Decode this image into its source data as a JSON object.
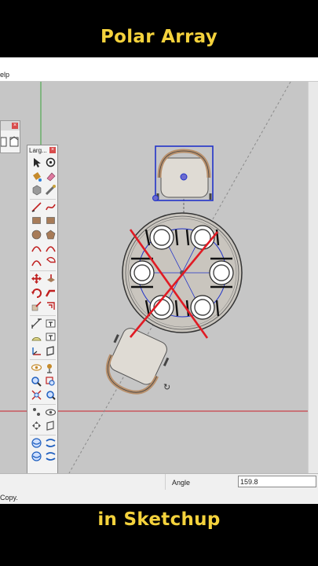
{
  "captions": {
    "top": "Polar Array",
    "bottom": "in Sketchup"
  },
  "menubar": {
    "visible_fragment": "elp"
  },
  "toolbars": {
    "large_tool_set": {
      "title": "Larg...",
      "tools": [
        {
          "name": "select-tool-icon",
          "color": "#2a2a2a",
          "shape": "arrow"
        },
        {
          "name": "orbit-tool-icon",
          "color": "#2a2a2a",
          "shape": "orbit"
        },
        {
          "name": "paint-bucket-icon",
          "color": "#c58a2b",
          "shape": "bucket"
        },
        {
          "name": "eraser-icon",
          "color": "#e07aa0",
          "shape": "eraser"
        },
        {
          "name": "make-component-icon",
          "color": "#9a9a9a",
          "shape": "cube"
        },
        {
          "name": "tape-measure-icon",
          "color": "#6b6b6b",
          "shape": "tape"
        },
        {
          "name": "line-tool-icon",
          "color": "#c02020",
          "shape": "line"
        },
        {
          "name": "freehand-tool-icon",
          "color": "#c02020",
          "shape": "freehand"
        },
        {
          "name": "rectangle-tool-icon",
          "color": "#a77b58",
          "shape": "rect"
        },
        {
          "name": "rotated-rectangle-icon",
          "color": "#a77b58",
          "shape": "rect"
        },
        {
          "name": "circle-tool-icon",
          "color": "#a77b58",
          "shape": "circle"
        },
        {
          "name": "polygon-tool-icon",
          "color": "#a77b58",
          "shape": "poly"
        },
        {
          "name": "arc-tool-icon",
          "color": "#c02020",
          "shape": "arc"
        },
        {
          "name": "two-point-arc-icon",
          "color": "#c02020",
          "shape": "arc"
        },
        {
          "name": "three-point-arc-icon",
          "color": "#c02020",
          "shape": "arc"
        },
        {
          "name": "pie-tool-icon",
          "color": "#c02020",
          "shape": "pie"
        },
        {
          "name": "move-tool-icon",
          "color": "#c02020",
          "shape": "move"
        },
        {
          "name": "push-pull-icon",
          "color": "#a77b58",
          "shape": "pushpull"
        },
        {
          "name": "rotate-tool-icon",
          "color": "#c02020",
          "shape": "rotate"
        },
        {
          "name": "follow-me-icon",
          "color": "#c02020",
          "shape": "followme"
        },
        {
          "name": "scale-tool-icon",
          "color": "#c02020",
          "shape": "scale"
        },
        {
          "name": "offset-tool-icon",
          "color": "#c02020",
          "shape": "offset"
        },
        {
          "name": "dimension-tool-icon",
          "color": "#333333",
          "shape": "dimension"
        },
        {
          "name": "text-tool-icon",
          "color": "#333333",
          "shape": "text"
        },
        {
          "name": "protractor-icon",
          "color": "#6a6a20",
          "shape": "protractor"
        },
        {
          "name": "3d-text-icon",
          "color": "#333333",
          "shape": "text"
        },
        {
          "name": "axes-tool-icon",
          "color": "#333333",
          "shape": "axes"
        },
        {
          "name": "section-plane-icon",
          "color": "#333333",
          "shape": "section"
        },
        {
          "name": "look-around-icon",
          "color": "#c58a2b",
          "shape": "eye"
        },
        {
          "name": "position-camera-icon",
          "color": "#c58a2b",
          "shape": "camera"
        },
        {
          "name": "zoom-tool-icon",
          "color": "#1f5fbf",
          "shape": "zoom"
        },
        {
          "name": "zoom-window-icon",
          "color": "#c02020",
          "shape": "zoomwin"
        },
        {
          "name": "zoom-extents-icon",
          "color": "#c02020",
          "shape": "extents"
        },
        {
          "name": "previous-view-icon",
          "color": "#1f5fbf",
          "shape": "prev"
        },
        {
          "name": "walk-tool-icon",
          "color": "#555555",
          "shape": "walk"
        },
        {
          "name": "eye-icon",
          "color": "#555555",
          "shape": "eye"
        },
        {
          "name": "pan-tool-icon",
          "color": "#555555",
          "shape": "pan"
        },
        {
          "name": "section-cut-icon",
          "color": "#555555",
          "shape": "section"
        },
        {
          "name": "warehouse-icon",
          "color": "#1f5fbf",
          "shape": "warehouse"
        },
        {
          "name": "share-model-icon",
          "color": "#1f5fbf",
          "shape": "share"
        },
        {
          "name": "extension-warehouse-icon",
          "color": "#1f5fbf",
          "shape": "warehouse"
        },
        {
          "name": "layout-icon",
          "color": "#1f5fbf",
          "shape": "share"
        }
      ]
    }
  },
  "vcb": {
    "label": "Angle",
    "value": "159.8"
  },
  "status": {
    "text": "Copy."
  },
  "colors": {
    "viewport_bg": "#c6c6c6",
    "red_axis": "#c9202a",
    "green_axis": "#3aa43a",
    "blue_selection": "#2233c8",
    "cross_mark": "#e01b24",
    "caption": "#f4d23c"
  }
}
